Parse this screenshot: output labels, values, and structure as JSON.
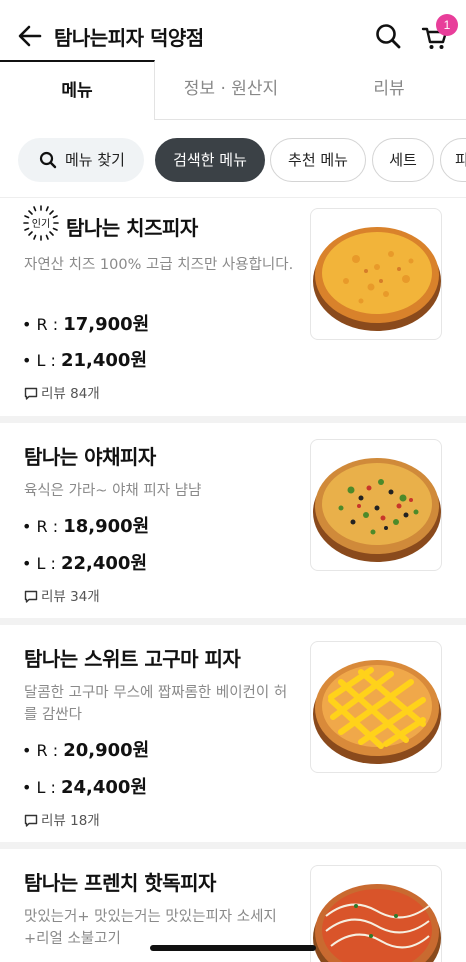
{
  "header": {
    "title": "탐나는피자 덕양점",
    "cart_count": "1"
  },
  "tabs": [
    {
      "label": "메뉴"
    },
    {
      "label": "정보 · 원산지"
    },
    {
      "label": "리뷰"
    }
  ],
  "chips": [
    {
      "label": "메뉴 찾기"
    },
    {
      "label": "검색한 메뉴"
    },
    {
      "label": "추천 메뉴"
    },
    {
      "label": "세트"
    },
    {
      "label": "피"
    }
  ],
  "popular_badge": "인기",
  "items": [
    {
      "name": "탐나는 치즈피자",
      "description": "자연산 치즈 100%  고급 치즈만 사용합니다.",
      "price_r_label": "• R : ",
      "price_r": "17,900원",
      "price_l_label": "• L : ",
      "price_l": "21,400원",
      "review": "리뷰 84개"
    },
    {
      "name": "탐나는 야채피자",
      "description": "육식은 가라~ 야채 피자 냠냠",
      "price_r_label": "• R : ",
      "price_r": "18,900원",
      "price_l_label": "• L : ",
      "price_l": "22,400원",
      "review": "리뷰 34개"
    },
    {
      "name": "탐나는 스위트 고구마 피자",
      "description": "달콤한 고구마 무스에 짭짜롬한 베이컨이 허를 감싼다",
      "price_r_label": "• R : ",
      "price_r": "20,900원",
      "price_l_label": "• L : ",
      "price_l": "24,400원",
      "review": "리뷰 18개"
    },
    {
      "name": "탐나는 프렌치 핫독피자",
      "description": "맛있는거+ 맛있는거는 맛있는피자 소세지+리얼 소불고기"
    }
  ],
  "colors": {
    "accent_badge": "#e83e9a",
    "active_chip": "#3b4146"
  }
}
